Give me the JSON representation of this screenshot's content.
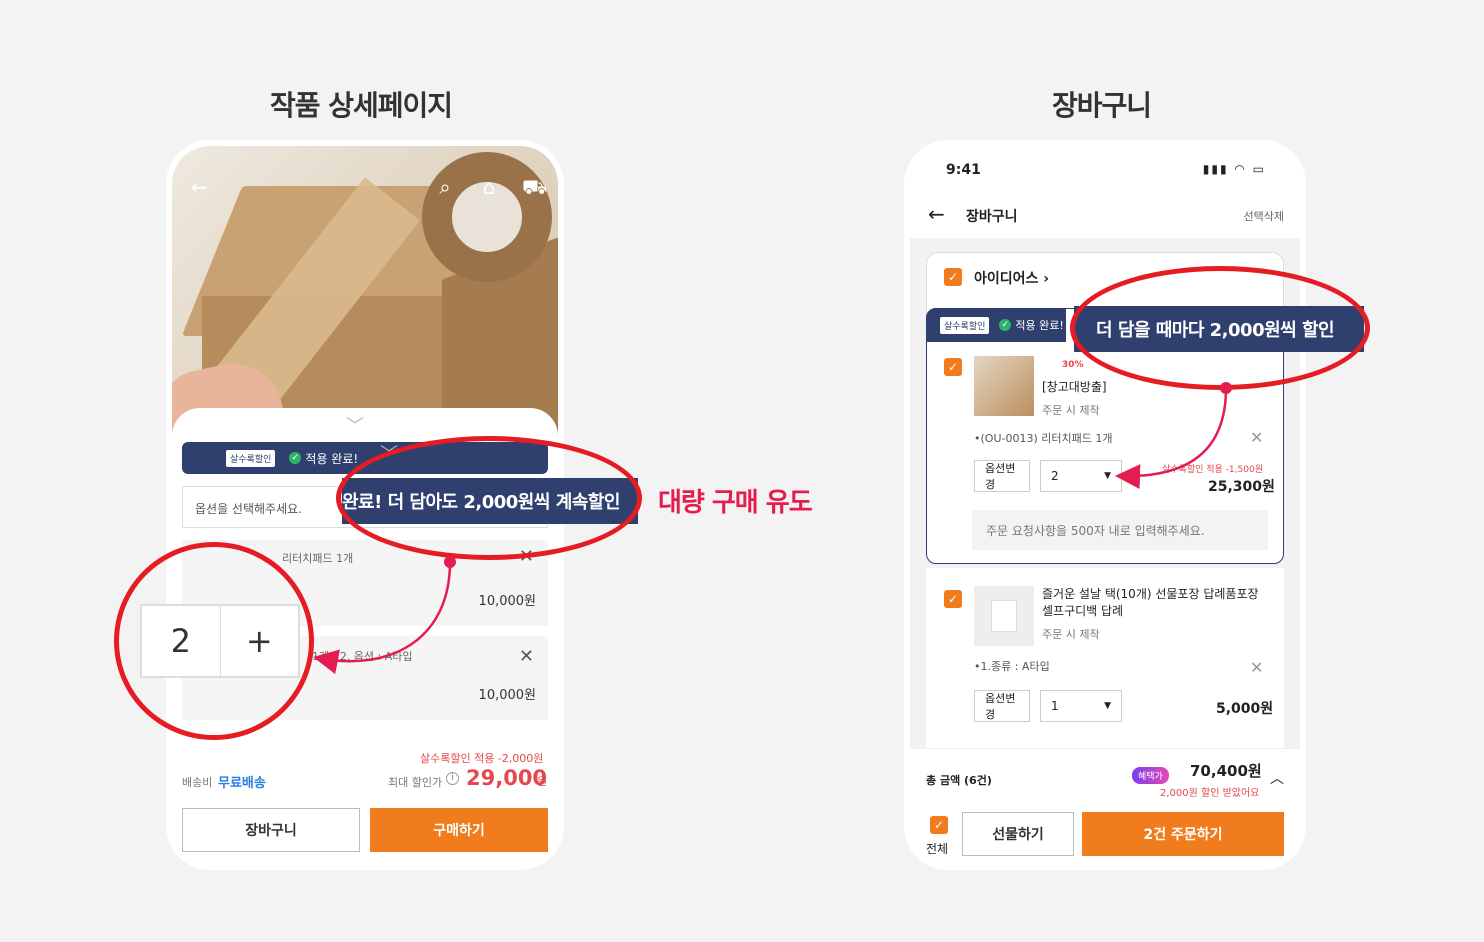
{
  "left": {
    "heading": "작품 상세페이지",
    "discount_pill": "살수록할인",
    "discount_done": "적용 완료!",
    "banner": "완료! 더 담아도 2,000원씩 계속할인",
    "select_placeholder": "옵션을 선택해주세요.",
    "option1_text": "리터치패드 1개",
    "option1_price": "10,000원",
    "option2_text": "1개 / 2. 옵션 : A타입",
    "option2_price": "10,000원",
    "stepper_value": "2",
    "stepper_plus": "+",
    "applied_discount": "살수록할인 적용 -2,000원",
    "shipping_label": "배송비",
    "shipping_value": "무료배송",
    "max_discount_label": "최대 할인가",
    "price": "29,000",
    "price_unit": "원",
    "cart_button": "장바구니",
    "buy_button": "구매하기"
  },
  "callout": "대량 구매 유도",
  "right": {
    "heading": "장바구니",
    "time": "9:41",
    "status_icons": "▮▮▮ ◠ ▭",
    "title": "장바구니",
    "select_delete": "선택삭제",
    "shop_name": "아이디어스",
    "discount_pill": "살수록할인",
    "discount_done": "적용 완료!",
    "banner": "더 담을 때마다 2,000원씩 할인",
    "item1_badge": "30%",
    "item1_name": "[창고대방출]",
    "item1_made": "주문 시 제작",
    "item1_option": "•(OU-0013) 리터치패드 1개",
    "option_change": "옵션변경",
    "item1_qty": "2",
    "item1_discount": "살수록할인 적용 -1,500원",
    "item1_price": "25,300원",
    "memo_placeholder": "주문 요청사항을 500자 내로 입력해주세요.",
    "item2_name": "즐거운 설날 택(10개) 선물포장 답례품포장 셀프구디백 답례",
    "item2_made": "주문 시 제작",
    "item2_option": "•1.종류 : A타입",
    "item2_qty": "1",
    "item2_price": "5,000원",
    "total_label": "총 금액 (6건)",
    "benefit_badge": "혜택가",
    "total_price": "70,400원",
    "saved_text": "2,000원 할인 받았어요",
    "all_label": "전체",
    "gift_button": "선물하기",
    "order_button": "2건 주문하기"
  },
  "colors": {
    "accent": "#f07c1e",
    "navy": "#2f3f6e",
    "highlight": "#e51c23",
    "callout": "#e51c4f"
  }
}
